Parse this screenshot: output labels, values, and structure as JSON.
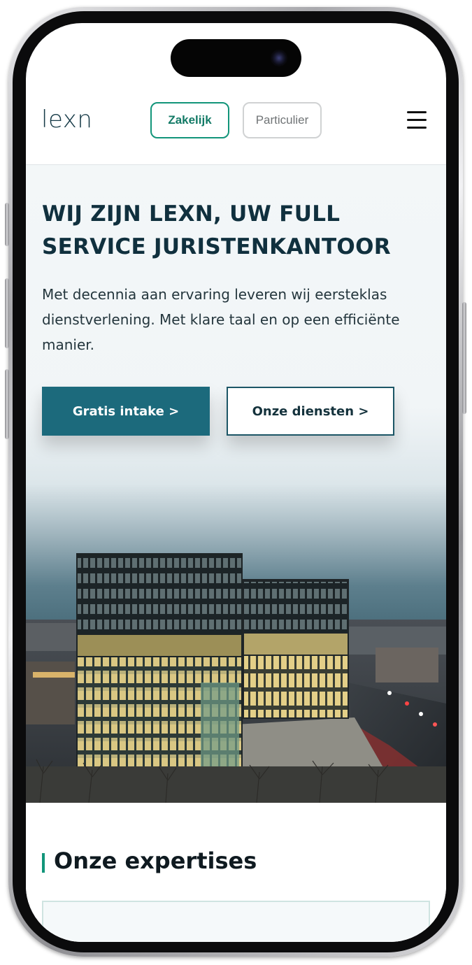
{
  "header": {
    "logo": "lexn",
    "segments": [
      {
        "label": "Zakelijk",
        "active": true
      },
      {
        "label": "Particulier",
        "active": false
      }
    ],
    "menu_icon": "hamburger-menu-icon"
  },
  "hero": {
    "title": "WIJ ZIJN LEXN, UW FULL SERVICE JURISTENKANTOOR",
    "text": "Met decennia aan ervaring leveren wij eersteklas dienstverlening. Met klare taal en op een efficiënte manier.",
    "primary_button": "Gratis intake >",
    "secondary_button": "Onze diensten >"
  },
  "expertises": {
    "title": "Onze expertises"
  },
  "colors": {
    "brand_dark": "#10303e",
    "accent_green": "#12957a",
    "primary_button": "#1c6a7c"
  }
}
